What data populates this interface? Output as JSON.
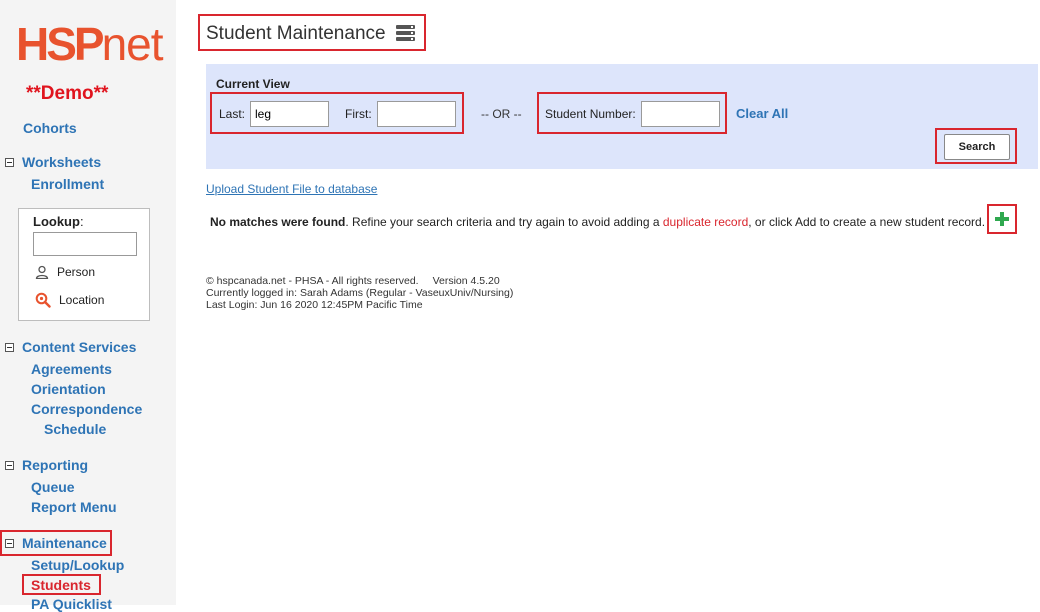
{
  "sidebar": {
    "logo": {
      "hsp": "HSP",
      "net": "net"
    },
    "demo": "**Demo**",
    "cohorts": "Cohorts",
    "worksheets": {
      "label": "Worksheets",
      "items": [
        "Enrollment"
      ]
    },
    "lookup": {
      "label": "Lookup",
      "colon": ":",
      "options": [
        "Person",
        "Location"
      ]
    },
    "content_services": {
      "label": "Content Services",
      "items": [
        "Agreements",
        "Orientation",
        "Correspondence",
        "Schedule"
      ]
    },
    "reporting": {
      "label": "Reporting",
      "items": [
        "Queue",
        "Report Menu"
      ]
    },
    "maintenance": {
      "label": "Maintenance",
      "items": [
        "Setup/Lookup",
        "Students",
        "PA Quicklist"
      ]
    }
  },
  "page": {
    "title": "Student Maintenance",
    "title_icon": "database-icon"
  },
  "search": {
    "current_view": "Current View",
    "last_label": "Last:",
    "last_value": "leg",
    "first_label": "First:",
    "first_value": "",
    "or": "-- OR --",
    "student_number_label": "Student Number:",
    "student_number_value": "",
    "clear_all": "Clear All",
    "search_button": "Search"
  },
  "upload_link": "Upload Student File to database",
  "message": {
    "bold": "No matches were found",
    "text1": ". Refine your search criteria and try again to avoid adding a ",
    "duplicate": "duplicate record",
    "text2": ", or click Add to create a new student record."
  },
  "footer": {
    "copyright": "© hspcanada.net - PHSA - All rights reserved.",
    "version": "Version 4.5.20",
    "logged_in": "Currently logged in: Sarah Adams (Regular - VaseuxUniv/Nursing)",
    "last_login": "Last Login: Jun 16 2020 12:45PM Pacific Time"
  },
  "colors": {
    "highlight": "#d9262e",
    "link": "#2e74b5",
    "logo": "#e8532e",
    "panel": "#dde5fb",
    "add": "#2fa84f"
  }
}
